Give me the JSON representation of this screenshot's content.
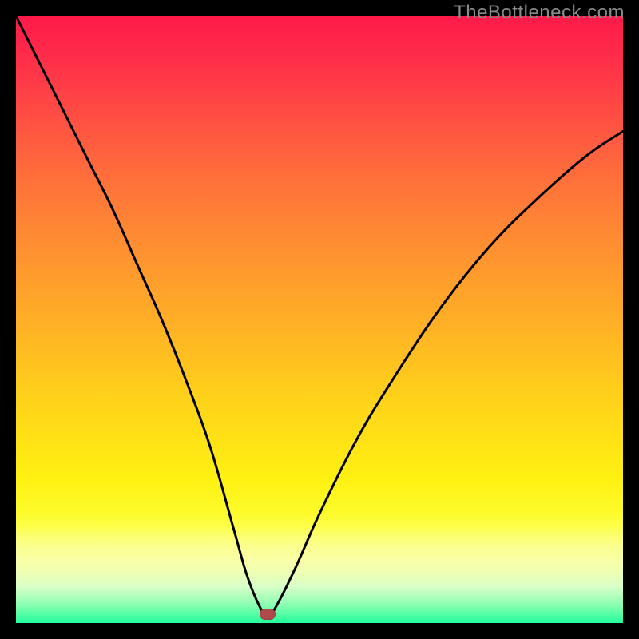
{
  "watermark": "TheBottleneck.com",
  "chart_data": {
    "type": "line",
    "title": "",
    "xlabel": "",
    "ylabel": "",
    "xlim": [
      0,
      100
    ],
    "ylim": [
      0,
      100
    ],
    "gradient_meaning": "vertical color gradient red (high bottleneck) to green (no bottleneck)",
    "marker": {
      "x": 41.5,
      "y": 1.5,
      "color": "#b04a4a"
    },
    "series": [
      {
        "name": "bottleneck-curve",
        "x": [
          0,
          4,
          8,
          12,
          16,
          20,
          24,
          28,
          32,
          36,
          38,
          40,
          41.5,
          43,
          46,
          50,
          56,
          62,
          70,
          78,
          86,
          94,
          100
        ],
        "y": [
          100,
          92,
          84,
          76,
          68,
          59,
          50,
          40,
          29,
          15,
          8,
          3,
          1,
          3,
          9,
          18,
          30,
          40,
          52,
          62,
          70,
          77,
          81
        ]
      }
    ],
    "notes": "Values are approximate percentages estimated from axis-free plot; minimum (optimal point) at x≈41.5."
  }
}
